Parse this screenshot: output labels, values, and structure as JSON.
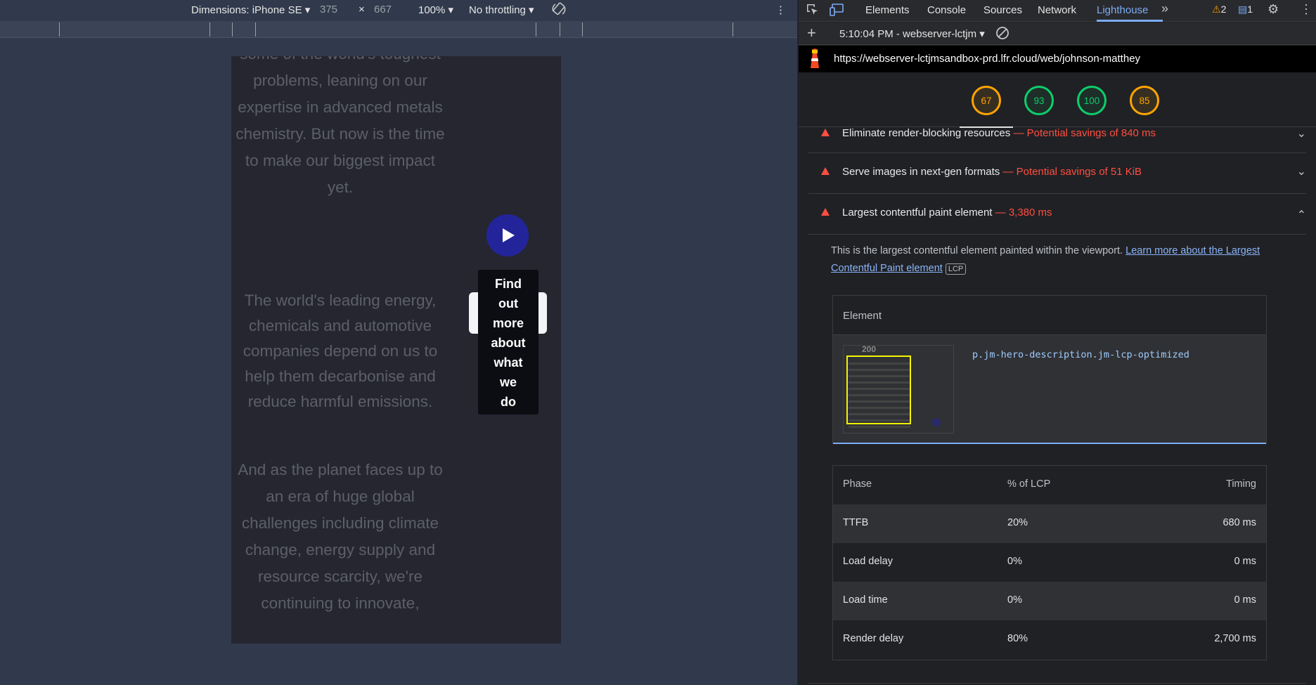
{
  "device_toolbar": {
    "dimensions_label": "Dimensions: iPhone SE",
    "width": "375",
    "times": "×",
    "height": "667",
    "zoom": "100%",
    "throttling": "No throttling",
    "more": "⋮"
  },
  "page": {
    "para1": "some of the world's toughest problems, leaning on our expertise in advanced metals chemistry. But now is the time to make our biggest impact yet.",
    "para2": "The world's leading energy, chemicals and automotive companies depend on us to help them decarbonise and reduce harmful emissions.",
    "para3": "And as the planet faces up to an era of huge global challenges including climate change, energy supply and resource scarcity, we're continuing to innovate,",
    "find_words": [
      "Find",
      "out",
      "more",
      "about",
      "what",
      "we",
      "do"
    ]
  },
  "devtools": {
    "tabs": [
      "Elements",
      "Console",
      "Sources",
      "Network",
      "Lighthouse"
    ],
    "active_tab": "Lighthouse",
    "warnings_count": "2",
    "messages_count": "1",
    "report_time": "5:10:04 PM - webserver-lctjm",
    "url": "https://webserver-lctjmsandbox-prd.lfr.cloud/web/johnson-matthey",
    "scores": [
      {
        "value": "67",
        "color": "#ffa400"
      },
      {
        "value": "93",
        "color": "#0cce6b"
      },
      {
        "value": "100",
        "color": "#0cce6b"
      },
      {
        "value": "85",
        "color": "#ffa400"
      }
    ],
    "audits": [
      {
        "title": "Eliminate render-blocking resources",
        "savings": "— Potential savings of 840 ms"
      },
      {
        "title": "Serve images in next-gen formats",
        "savings": "— Potential savings of 51 KiB"
      },
      {
        "title": "Largest contentful paint element",
        "savings": "— 3,380 ms"
      }
    ],
    "lcp_description": "This is the largest contentful element painted within the viewport.",
    "lcp_link": "Learn more about the Largest Contentful Paint element",
    "lcp_badge": "LCP",
    "element_header": "Element",
    "element_selector": "p.jm-hero-description.jm-lcp-optimized",
    "thumb_title": "200",
    "phase_headers": {
      "phase": "Phase",
      "pct": "% of LCP",
      "timing": "Timing"
    },
    "phases": [
      {
        "phase": "TTFB",
        "pct": "20%",
        "timing": "680 ms"
      },
      {
        "phase": "Load delay",
        "pct": "0%",
        "timing": "0 ms"
      },
      {
        "phase": "Load time",
        "pct": "0%",
        "timing": "0 ms"
      },
      {
        "phase": "Render delay",
        "pct": "80%",
        "timing": "2,700 ms"
      }
    ]
  }
}
